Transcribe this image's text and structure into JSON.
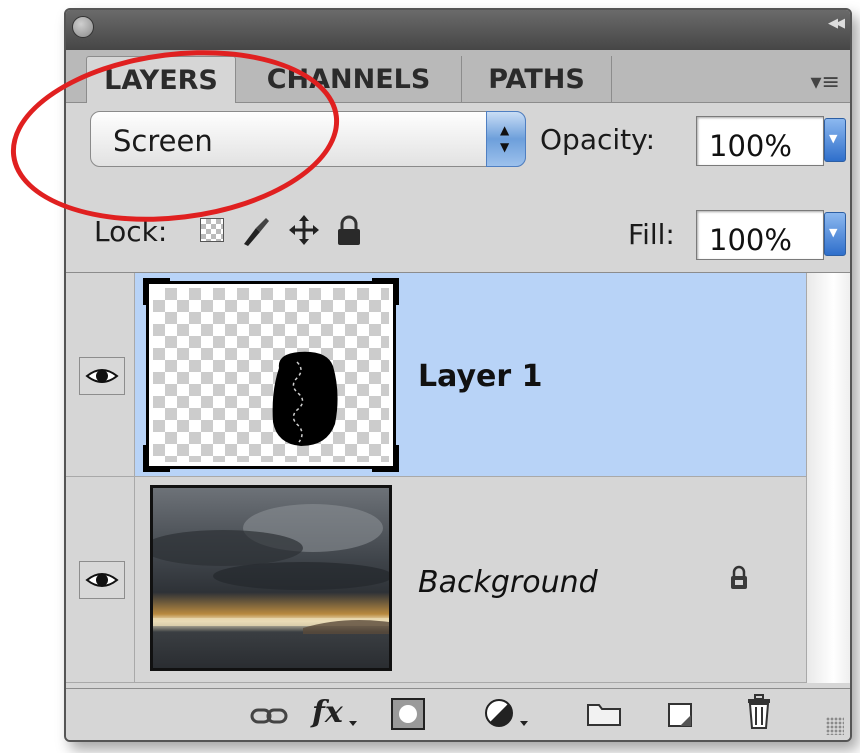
{
  "tabs": [
    {
      "label": "LAYERS",
      "active": true
    },
    {
      "label": "CHANNELS",
      "active": false
    },
    {
      "label": "PATHS",
      "active": false
    }
  ],
  "blend_mode": {
    "value": "Screen"
  },
  "opacity": {
    "label": "Opacity:",
    "value": "100%"
  },
  "lock": {
    "label": "Lock:"
  },
  "fill": {
    "label": "Fill:",
    "value": "100%"
  },
  "layers": [
    {
      "name": "Layer 1",
      "visible": true,
      "selected": true,
      "italic": false,
      "locked": false
    },
    {
      "name": "Background",
      "visible": true,
      "selected": false,
      "italic": true,
      "locked": true
    }
  ],
  "bottom_icons": [
    "link-layers-icon",
    "fx-icon",
    "layer-mask-icon",
    "adjustment-layer-icon",
    "new-group-icon",
    "new-layer-icon",
    "trash-icon"
  ],
  "fx_symbol": "fx",
  "colors": {
    "annotation": "#e02020",
    "selection": "#b8d3f7",
    "panel": "#d6d6d6"
  }
}
